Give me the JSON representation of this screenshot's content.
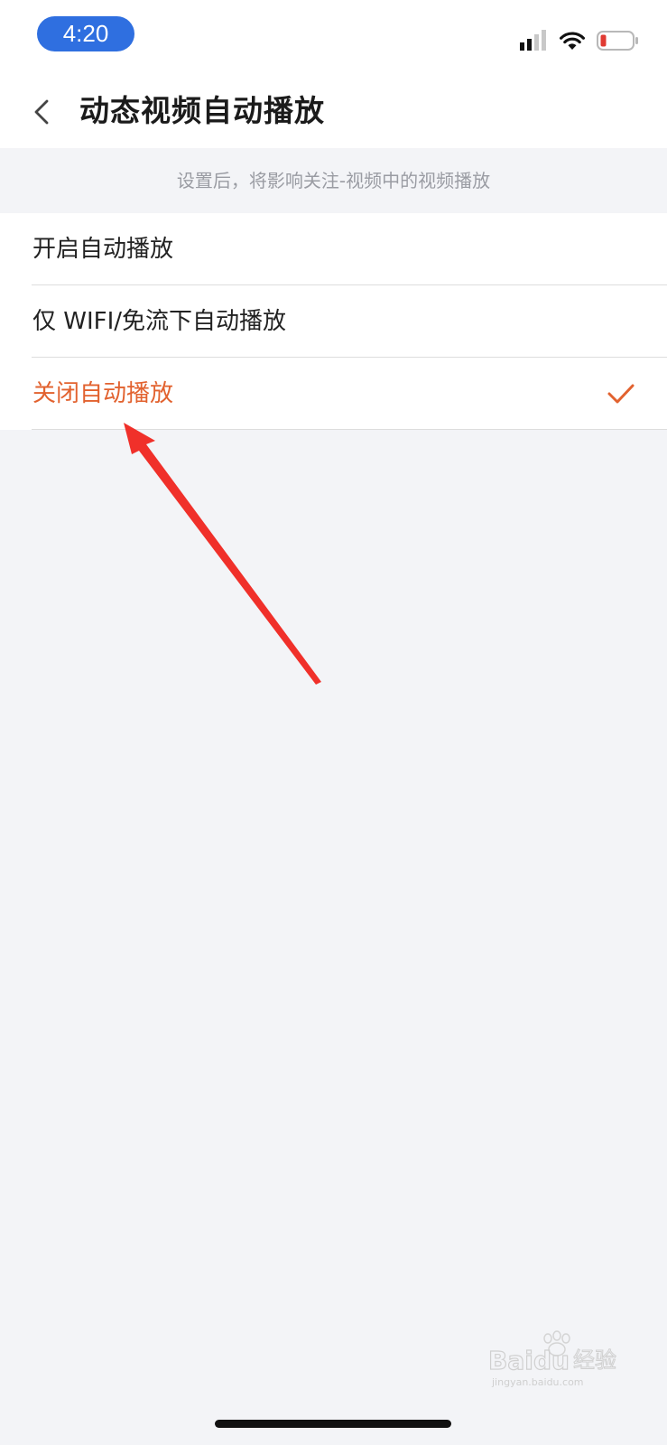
{
  "status_bar": {
    "time": "4:20",
    "icons": [
      "cellular-signal-icon",
      "wifi-icon",
      "battery-low-icon"
    ]
  },
  "nav": {
    "back_icon": "chevron-left-icon",
    "title": "动态视频自动播放"
  },
  "hint": "设置后，将影响关注-视频中的视频播放",
  "options": [
    {
      "label": "开启自动播放",
      "selected": false
    },
    {
      "label": "仅 WIFI/免流下自动播放",
      "selected": false
    },
    {
      "label": "关闭自动播放",
      "selected": true
    }
  ],
  "selected_check_icon": "checkmark-icon",
  "watermark": {
    "text": "Baidu经验",
    "subtext": "jingyan.baidu.com"
  },
  "colors": {
    "accent": "#e2622f",
    "time_pill": "#2f6fe0",
    "annotation_arrow": "#f0302a",
    "background": "#f3f4f7"
  }
}
